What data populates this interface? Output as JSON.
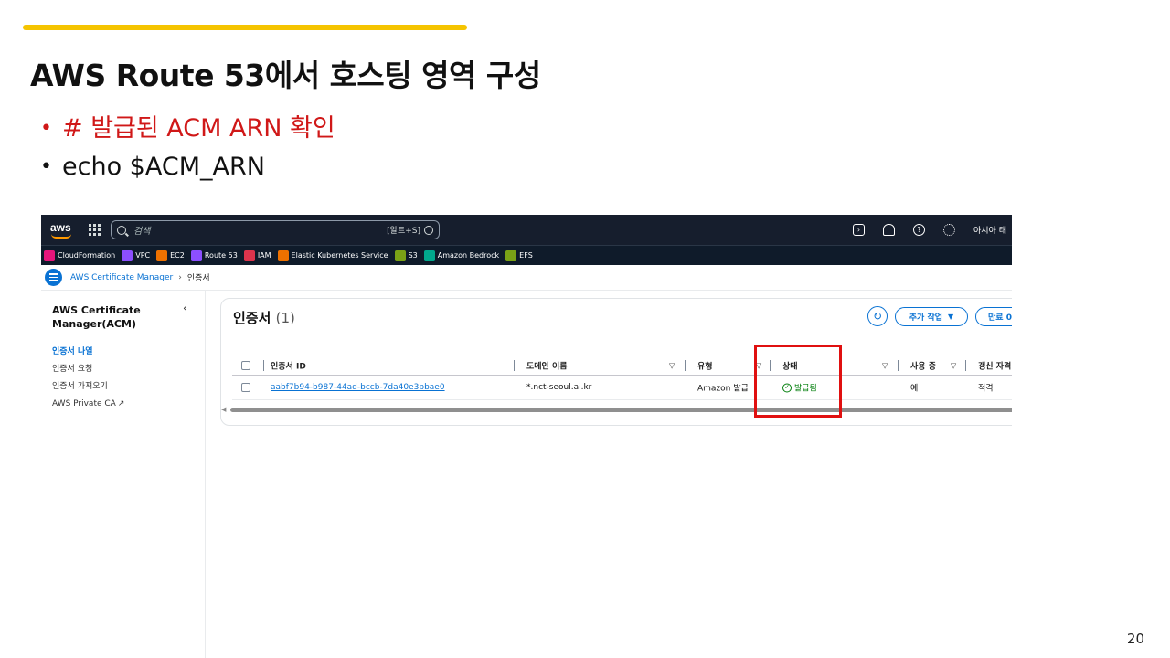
{
  "slide": {
    "title": "AWS Route 53에서 호스팅 영역 구성",
    "bullets": [
      {
        "text": "# 발급된 ACM ARN 확인",
        "color": "#d01818"
      },
      {
        "text": "echo $ACM_ARN",
        "color": "#111111"
      }
    ],
    "page_number": "20",
    "accent_color": "#f5c400",
    "highlight_color": "#e01010"
  },
  "console": {
    "topnav": {
      "logo_text": "aws",
      "search_placeholder": "검색",
      "search_shortcut": "[알트+S]",
      "icons": [
        "cloudshell-icon",
        "bell-icon",
        "help-icon",
        "gear-icon"
      ],
      "region_label": "아시아 태"
    },
    "favorites": [
      {
        "label": "CloudFormation",
        "color": "#e7157b"
      },
      {
        "label": "VPC",
        "color": "#8c4fff"
      },
      {
        "label": "EC2",
        "color": "#ed7100"
      },
      {
        "label": "Route 53",
        "color": "#8c4fff"
      },
      {
        "label": "IAM",
        "color": "#dd344c"
      },
      {
        "label": "Elastic Kubernetes Service",
        "color": "#ed7100"
      },
      {
        "label": "S3",
        "color": "#7aa116"
      },
      {
        "label": "Amazon Bedrock",
        "color": "#01a88d"
      },
      {
        "label": "EFS",
        "color": "#7aa116"
      }
    ],
    "breadcrumb": {
      "link": "AWS Certificate Manager",
      "current": "인증서"
    },
    "sidebar": {
      "title": "AWS Certificate Manager(ACM)",
      "items": [
        {
          "label": "인증서 나열",
          "active": true
        },
        {
          "label": "인증서 요청",
          "active": false
        },
        {
          "label": "인증서 가져오기",
          "active": false
        },
        {
          "label": "AWS Private CA",
          "active": false
        }
      ]
    },
    "panel": {
      "title": "인증서",
      "count": "(1)",
      "actions_label": "추가 작업",
      "expire_label": "만료 0"
    },
    "table": {
      "columns": [
        "인증서 ID",
        "도메인 이름",
        "유형",
        "상태",
        "사용 중",
        "갱신 자격"
      ],
      "rows": [
        {
          "id": "aabf7b94-b987-44ad-bccb-7da40e3bbae0",
          "domain": "*.nct-seoul.ai.kr",
          "type": "Amazon 발급",
          "status": "발급됨",
          "in_use": "예",
          "renewal": "적격"
        }
      ]
    }
  }
}
